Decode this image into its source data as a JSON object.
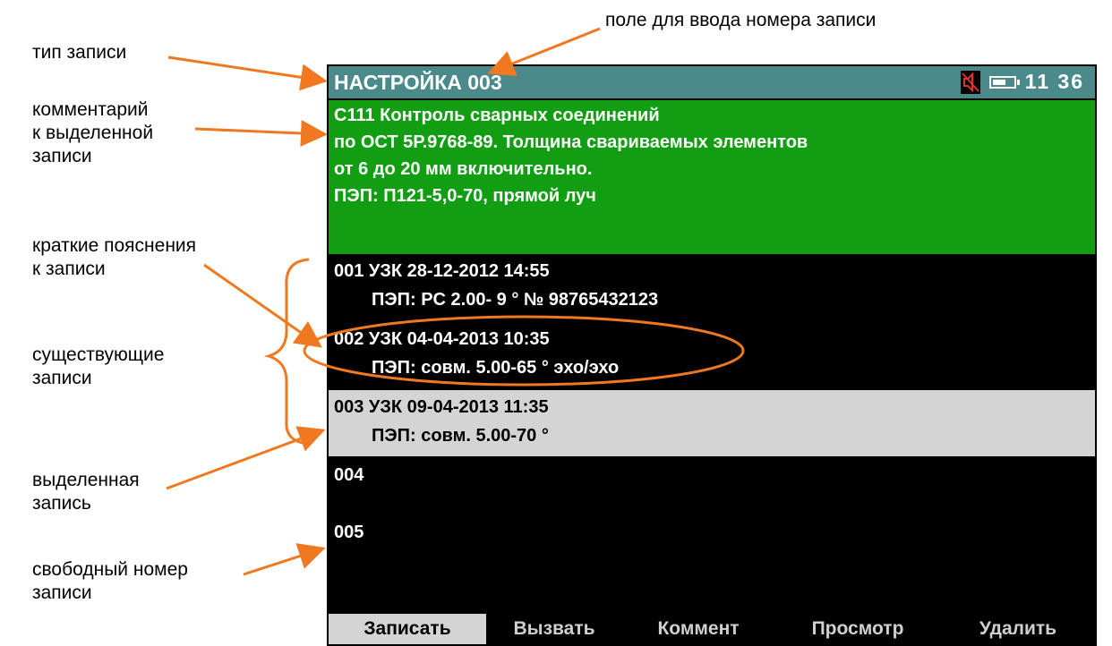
{
  "annotations": {
    "record_number_field": "поле для ввода номера записи",
    "record_type": "тип записи",
    "comment_line1": "комментарий",
    "comment_line2": "к выделенной",
    "comment_line3": "записи",
    "short_notes_line1": "краткие пояснения",
    "short_notes_line2": "к записи",
    "existing_line1": "существующие",
    "existing_line2": "записи",
    "selected_line1": "выделенная",
    "selected_line2": "запись",
    "free_line1": "свободный номер",
    "free_line2": "записи"
  },
  "device": {
    "title": "НАСТРОЙКА 003",
    "clock": "11 36",
    "status_icons": [
      "mute-speaker-icon",
      "battery-icon"
    ],
    "colors": {
      "title_bar": "#4a8a8a",
      "comment_bg": "#129e12",
      "selected_bg": "#d4d4d4",
      "annotation_arrow": "#f07820"
    },
    "comment_lines": [
      "С111 Контроль сварных соединений",
      "по ОСТ 5Р.9768-89. Толщина свариваемых элементов",
      "от 6 до 20 мм включительно.",
      "ПЭП: П121-5,0-70, прямой луч"
    ],
    "records": [
      {
        "line1": "001 УЗК  28-12-2012 14:55",
        "line2": "ПЭП:  PC 2.00- 9 ° №  98765432123"
      },
      {
        "line1": "002 УЗК  04-04-2013 10:35",
        "line2": "ПЭП:  совм. 5.00-65 ° эхо/эхо"
      },
      {
        "line1": "003 УЗК  09-04-2013 11:35",
        "line2": "ПЭП:  совм. 5.00-70 °"
      },
      {
        "line1": "004",
        "line2": ""
      },
      {
        "line1": "005",
        "line2": ""
      }
    ],
    "selected_record": "003",
    "softkeys": [
      "Записать",
      "Вызвать",
      "Коммент",
      "Просмотр",
      "Удалить"
    ],
    "active_softkey": "Записать"
  }
}
